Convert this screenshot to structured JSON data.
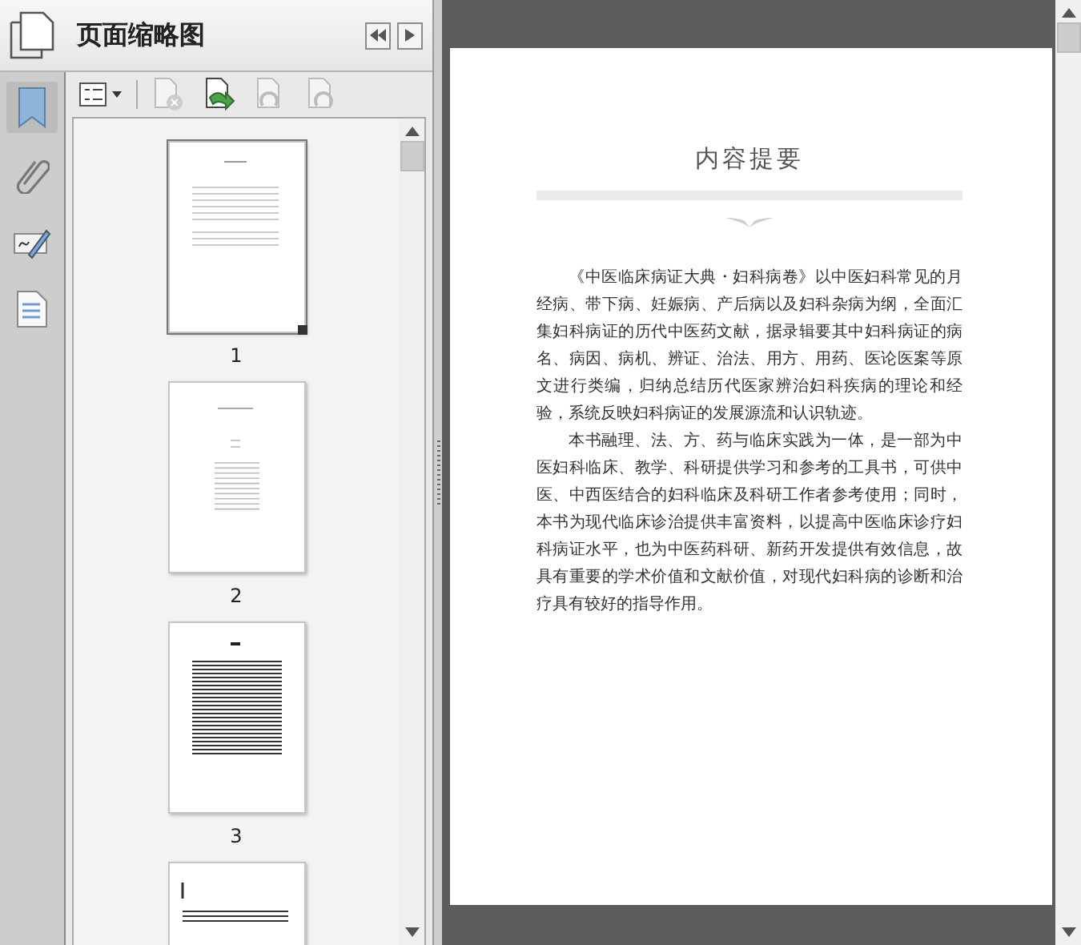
{
  "panel": {
    "title": "页面缩略图"
  },
  "rail": [
    {
      "kind": "bookmark",
      "selected": true
    },
    {
      "kind": "attachment",
      "selected": false
    },
    {
      "kind": "signature",
      "selected": false
    },
    {
      "kind": "pages",
      "selected": false
    }
  ],
  "toolbar": [
    {
      "kind": "options",
      "disabled": false
    },
    {
      "kind": "delete",
      "disabled": true
    },
    {
      "kind": "insert",
      "disabled": false
    },
    {
      "kind": "undo",
      "disabled": true
    },
    {
      "kind": "redo",
      "disabled": true
    }
  ],
  "thumbnails": [
    {
      "kind": "cover",
      "label": "1",
      "selected": true
    },
    {
      "kind": "contents",
      "label": "2",
      "selected": false
    },
    {
      "kind": "dense",
      "label": "3",
      "selected": false
    },
    {
      "kind": "sparse",
      "selected": false
    }
  ],
  "document": {
    "heading": "内容提要",
    "paragraphs": [
      "《中医临床病证大典・妇科病卷》以中医妇科常见的月经病、带下病、妊娠病、产后病以及妇科杂病为纲，全面汇集妇科病证的历代中医药文献，据录辑要其中妇科病证的病名、病因、病机、辨证、治法、用方、用药、医论医案等原文进行类编，归纳总结历代医家辨治妇科疾病的理论和经验，系统反映妇科病证的发展源流和认识轨迹。",
      "本书融理、法、方、药与临床实践为一体，是一部为中医妇科临床、教学、科研提供学习和参考的工具书，可供中医、中西医结合的妇科临床及科研工作者参考使用；同时，本书为现代临床诊治提供丰富资料，以提高中医临床诊疗妇科病证水平，也为中医药科研、新药开发提供有效信息，故具有重要的学术价值和文献价值，对现代妇科病的诊断和治疗具有较好的指导作用。"
    ]
  }
}
